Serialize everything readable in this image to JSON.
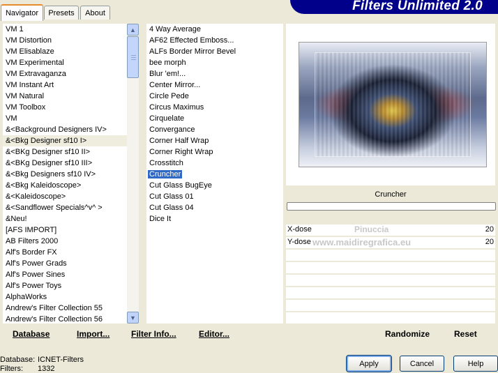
{
  "app": {
    "title": "Filters Unlimited 2.0"
  },
  "tabs": [
    {
      "label": "Navigator"
    },
    {
      "label": "Presets"
    },
    {
      "label": "About"
    }
  ],
  "categories": [
    "VM 1",
    "VM Distortion",
    "VM Elisablaze",
    "VM Experimental",
    "VM Extravaganza",
    "VM Instant Art",
    "VM Natural",
    "VM Toolbox",
    "VM",
    "&<Background Designers IV>",
    "&<Bkg Designer sf10 I>",
    "&<BKg Designer sf10 II>",
    "&<BKg Designer sf10 III>",
    "&<Bkg Designers sf10 IV>",
    "&<Bkg Kaleidoscope>",
    "&<Kaleidoscope>",
    "&<Sandflower Specials^v^ >",
    "&Neu!",
    "[AFS IMPORT]",
    "AB Filters 2000",
    "Alf's Border FX",
    "Alf's Power Grads",
    "Alf's Power Sines",
    "Alf's Power Toys",
    "AlphaWorks",
    "Andrew's Filter Collection 55",
    "Andrew's Filter Collection 56"
  ],
  "filters": [
    "4 Way Average",
    "AF62 Effected Emboss...",
    "ALFs Border Mirror Bevel",
    "bee morph",
    "Blur 'em!...",
    "Center Mirror...",
    "Circle Pede",
    "Circus Maximus",
    "Cirquelate",
    "Convergance",
    "Corner Half Wrap",
    "Corner Right Wrap",
    "Crosstitch",
    "Cruncher",
    "Cut Glass  BugEye",
    "Cut Glass 01",
    "Cut Glass 04",
    "Dice It"
  ],
  "selected_category": "&<Bkg Designer sf10 I>",
  "selected_filter": "Cruncher",
  "filter_name": "Cruncher",
  "params": [
    {
      "label": "X-dose",
      "value": "20"
    },
    {
      "label": "Y-dose",
      "value": "20"
    }
  ],
  "watermark": {
    "line1": "Pinuccia",
    "line2": "www.maidiregrafica.eu"
  },
  "links": {
    "database": "Database",
    "import": "Import...",
    "filter_info": "Filter Info...",
    "editor": "Editor...",
    "randomize": "Randomize",
    "reset": "Reset"
  },
  "status": {
    "database_label": "Database:",
    "database_value": "ICNET-Filters",
    "filters_label": "Filters:",
    "filters_value": "1332"
  },
  "buttons": {
    "apply": "Apply",
    "cancel": "Cancel",
    "help": "Help"
  },
  "colors": {
    "banner": "#00008b",
    "selection": "#316ac5",
    "tab_accent": "#e68b2c"
  }
}
